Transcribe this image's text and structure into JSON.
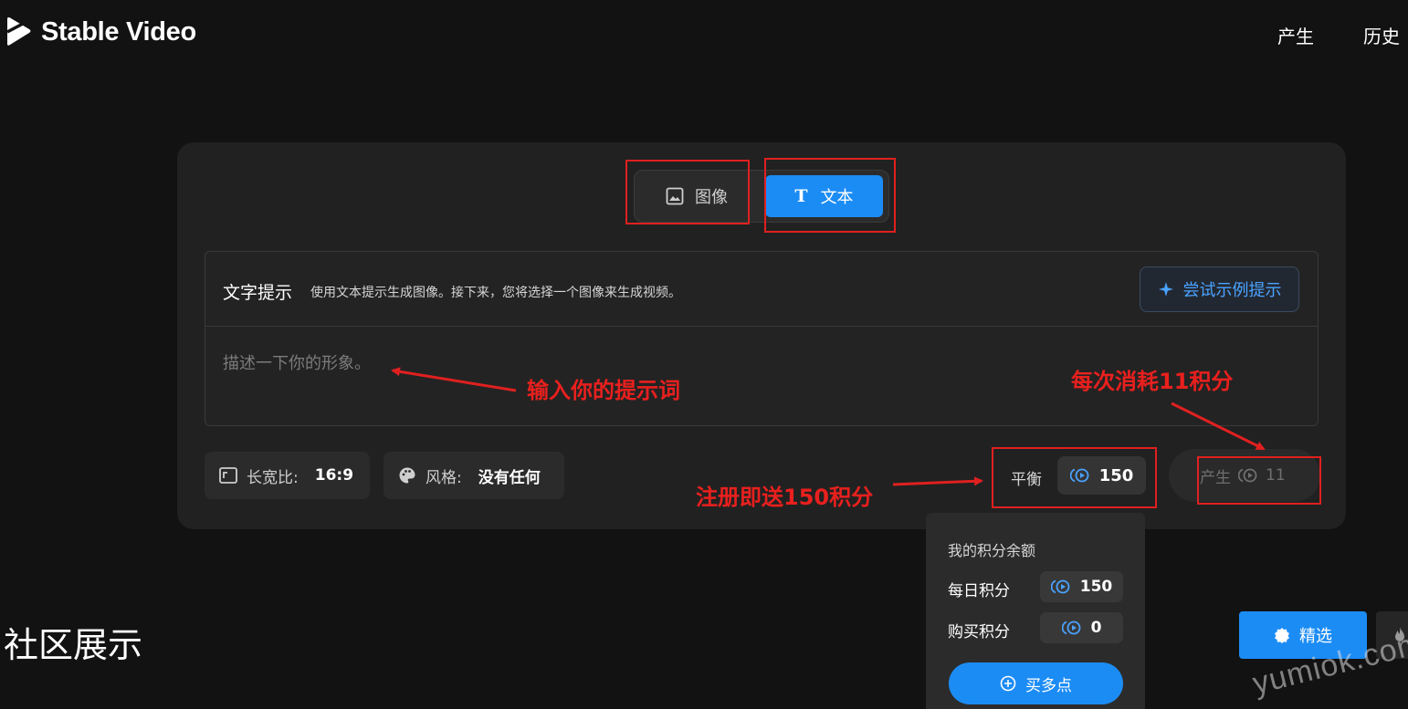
{
  "header": {
    "brand": "Stable Video",
    "nav": {
      "generate": "产生",
      "history": "历史"
    }
  },
  "mode": {
    "image_label": "图像",
    "text_label": "文本",
    "active": "text"
  },
  "prompt": {
    "title": "文字提示",
    "description": "使用文本提示生成图像。接下来，您将选择一个图像来生成视频。",
    "try_example": "尝试示例提示",
    "placeholder": "描述一下你的形象。"
  },
  "options": {
    "aspect_label": "长宽比:",
    "aspect_value": "16:9",
    "style_label": "风格:",
    "style_value": "没有任何"
  },
  "balance": {
    "label": "平衡",
    "value": "150"
  },
  "generate": {
    "label": "产生",
    "cost": "11"
  },
  "credits_popover": {
    "title": "我的积分余额",
    "daily_label": "每日积分",
    "daily_value": "150",
    "purchased_label": "购买积分",
    "purchased_value": "0",
    "buy_label": "买多点"
  },
  "community": {
    "title": "社区展示",
    "featured_label": "精选"
  },
  "annotations": {
    "input_prompt": "输入你的提示词",
    "cost_each": "每次消耗11积分",
    "signup_bonus": "注册即送150积分"
  },
  "watermark": "yumiok.com",
  "colors": {
    "accent": "#1c8cf5",
    "annotation": "#e02020",
    "background": "#121212",
    "panel": "#212121"
  }
}
